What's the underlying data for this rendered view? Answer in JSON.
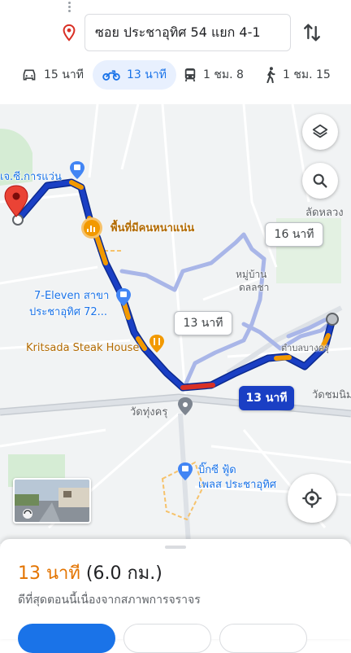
{
  "directions": {
    "destination": "ซอย ประชาอุทิศ 54 แยก 4-1",
    "modes": [
      {
        "icon": "car-icon",
        "label": "15 นาที"
      },
      {
        "icon": "motorcycle-icon",
        "label": "13 นาที",
        "active": true
      },
      {
        "icon": "transit-icon",
        "label": "1 ชม. 8"
      },
      {
        "icon": "walk-icon",
        "label": "1 ชม. 15"
      }
    ]
  },
  "map": {
    "places": {
      "top_left": "เจ.ซี.การแว่น",
      "busy_area": "พื้นที่มีคนหนาแน่น",
      "seven_line1": "7-Eleven สาขา",
      "seven_line2": "ประชาอุทิศ 72...",
      "steak": "Kritsada Steak House",
      "temple": "วัดทุ่งครุ",
      "bigc_line1": "บิ๊กซี ฟู้ด",
      "bigc_line2": "เพลส ประชาอุทิศ",
      "village_line1": "หมู่บ้าน",
      "village_line2": "ดลลชา",
      "right_top": "ลัดหลวง",
      "right_mid": "วัดชมนิม",
      "tambon": "ตำบลบางครุ"
    },
    "route_bubbles": {
      "alt1": "16 นาที",
      "alt2": "13 นาที",
      "primary": "13 นาที"
    },
    "colors": {
      "route_primary": "#1a3fc4",
      "route_alt": "#a9b6e8",
      "traffic_slow": "#f29900",
      "traffic_jam": "#d93025"
    }
  },
  "sheet": {
    "eta_time": "13 นาที",
    "eta_distance": "(6.0 กม.)",
    "note": "ดีที่สุดตอนนี้เนื่องจากสภาพการจราจร"
  }
}
